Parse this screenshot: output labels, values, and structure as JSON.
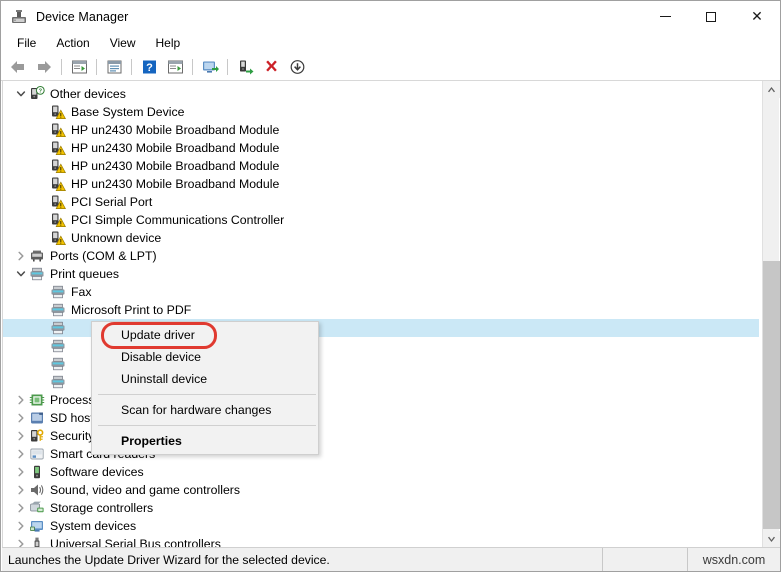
{
  "window": {
    "title": "Device Manager",
    "icon": "device-manager-icon",
    "minimize_label": "—",
    "maximize_label": "□",
    "close_label": "✕"
  },
  "menubar": {
    "items": [
      {
        "label": "File"
      },
      {
        "label": "Action"
      },
      {
        "label": "View"
      },
      {
        "label": "Help"
      }
    ]
  },
  "toolbar": {
    "buttons": [
      {
        "name": "back-icon",
        "tooltip": "Back"
      },
      {
        "name": "forward-icon",
        "tooltip": "Forward"
      },
      {
        "name": "separator-1",
        "tooltip": ""
      },
      {
        "name": "show-hide-console-tree-icon",
        "tooltip": "Show/Hide Console Tree"
      },
      {
        "name": "separator-2",
        "tooltip": ""
      },
      {
        "name": "properties-icon",
        "tooltip": "Properties"
      },
      {
        "name": "separator-3",
        "tooltip": ""
      },
      {
        "name": "help-icon",
        "tooltip": "Help"
      },
      {
        "name": "view-icon",
        "tooltip": "View"
      },
      {
        "name": "separator-4",
        "tooltip": ""
      },
      {
        "name": "scan-for-hardware-changes-icon",
        "tooltip": "Scan for hardware changes"
      },
      {
        "name": "separator-5",
        "tooltip": ""
      },
      {
        "name": "update-driver-icon",
        "tooltip": "Update driver"
      },
      {
        "name": "uninstall-device-icon",
        "tooltip": "Uninstall device"
      },
      {
        "name": "disable-device-icon",
        "tooltip": "Disable device"
      }
    ]
  },
  "tree": {
    "rows": [
      {
        "label": "Other devices",
        "indent": 0,
        "twisty": "expanded",
        "icon": "unknown-device-group-icon",
        "selected": false
      },
      {
        "label": "Base System Device",
        "indent": 1,
        "twisty": "none",
        "icon": "warning-device-icon",
        "selected": false
      },
      {
        "label": "HP un2430 Mobile Broadband Module",
        "indent": 1,
        "twisty": "none",
        "icon": "warning-device-icon",
        "selected": false
      },
      {
        "label": "HP un2430 Mobile Broadband Module",
        "indent": 1,
        "twisty": "none",
        "icon": "warning-device-icon",
        "selected": false
      },
      {
        "label": "HP un2430 Mobile Broadband Module",
        "indent": 1,
        "twisty": "none",
        "icon": "warning-device-icon",
        "selected": false
      },
      {
        "label": "HP un2430 Mobile Broadband Module",
        "indent": 1,
        "twisty": "none",
        "icon": "warning-device-icon",
        "selected": false
      },
      {
        "label": "PCI Serial Port",
        "indent": 1,
        "twisty": "none",
        "icon": "warning-device-icon",
        "selected": false
      },
      {
        "label": "PCI Simple Communications Controller",
        "indent": 1,
        "twisty": "none",
        "icon": "warning-device-icon",
        "selected": false
      },
      {
        "label": "Unknown device",
        "indent": 1,
        "twisty": "none",
        "icon": "warning-device-icon",
        "selected": false
      },
      {
        "label": "Ports (COM & LPT)",
        "indent": 0,
        "twisty": "collapsed",
        "icon": "ports-icon",
        "selected": false
      },
      {
        "label": "Print queues",
        "indent": 0,
        "twisty": "expanded",
        "icon": "printer-icon",
        "selected": false
      },
      {
        "label": "Fax",
        "indent": 1,
        "twisty": "none",
        "icon": "printer-icon",
        "selected": false
      },
      {
        "label": "Microsoft Print to PDF",
        "indent": 1,
        "twisty": "none",
        "icon": "printer-icon",
        "selected": false
      },
      {
        "label": "",
        "indent": 1,
        "twisty": "none",
        "icon": "printer-icon",
        "selected": true
      },
      {
        "label": "",
        "indent": 1,
        "twisty": "none",
        "icon": "printer-icon",
        "selected": false
      },
      {
        "label": "",
        "indent": 1,
        "twisty": "none",
        "icon": "printer-icon",
        "selected": false
      },
      {
        "label": "",
        "indent": 1,
        "twisty": "none",
        "icon": "printer-icon",
        "selected": false
      },
      {
        "label": "Processors",
        "indent": 0,
        "twisty": "collapsed",
        "icon": "processor-icon",
        "selected": false
      },
      {
        "label": "SD host adapters",
        "indent": 0,
        "twisty": "collapsed",
        "icon": "sd-host-icon",
        "selected": false
      },
      {
        "label": "Security devices",
        "indent": 0,
        "twisty": "collapsed",
        "icon": "security-device-icon",
        "selected": false
      },
      {
        "label": "Smart card readers",
        "indent": 0,
        "twisty": "collapsed",
        "icon": "smart-card-reader-icon",
        "selected": false
      },
      {
        "label": "Software devices",
        "indent": 0,
        "twisty": "collapsed",
        "icon": "software-device-icon",
        "selected": false
      },
      {
        "label": "Sound, video and game controllers",
        "indent": 0,
        "twisty": "collapsed",
        "icon": "sound-controller-icon",
        "selected": false
      },
      {
        "label": "Storage controllers",
        "indent": 0,
        "twisty": "collapsed",
        "icon": "storage-controller-icon",
        "selected": false
      },
      {
        "label": "System devices",
        "indent": 0,
        "twisty": "collapsed",
        "icon": "system-device-icon",
        "selected": false
      },
      {
        "label": "Universal Serial Bus controllers",
        "indent": 0,
        "twisty": "collapsed",
        "icon": "usb-controller-icon",
        "selected": false
      }
    ]
  },
  "context_menu": {
    "items": [
      {
        "label": "Update driver",
        "bold": false,
        "highlighted": true,
        "type": "item"
      },
      {
        "label": "Disable device",
        "bold": false,
        "highlighted": false,
        "type": "item"
      },
      {
        "label": "Uninstall device",
        "bold": false,
        "highlighted": false,
        "type": "item"
      },
      {
        "label": "",
        "bold": false,
        "highlighted": false,
        "type": "separator"
      },
      {
        "label": "Scan for hardware changes",
        "bold": false,
        "highlighted": false,
        "type": "item"
      },
      {
        "label": "",
        "bold": false,
        "highlighted": false,
        "type": "separator"
      },
      {
        "label": "Properties",
        "bold": true,
        "highlighted": false,
        "type": "item"
      }
    ],
    "highlight_color": "#e03a30"
  },
  "statusbar": {
    "message": "Launches the Update Driver Wizard for the selected device.",
    "watermark": "wsxdn.com"
  },
  "scrollbar": {
    "up_arrow": "▲",
    "down_arrow": "▼"
  }
}
